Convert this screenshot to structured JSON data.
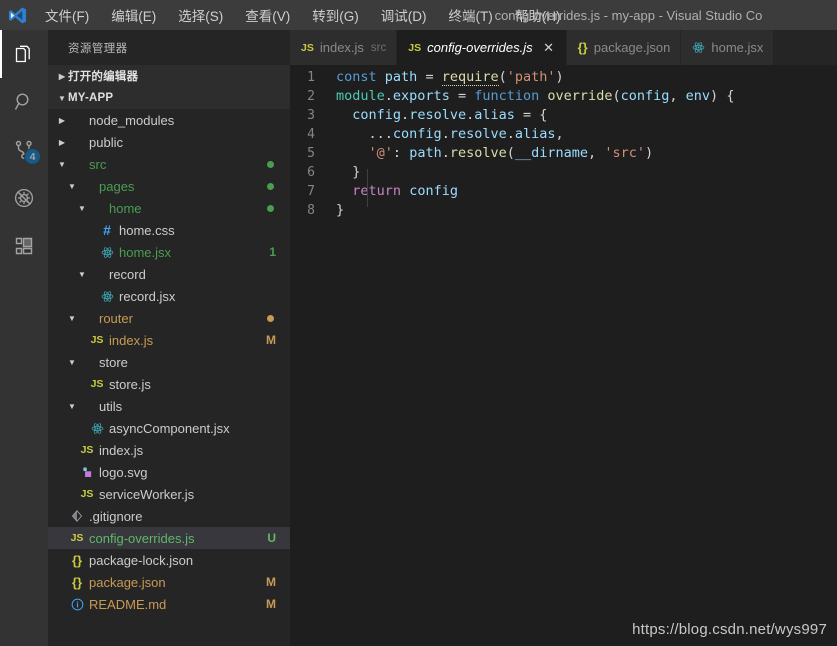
{
  "titlebar": {
    "logo_icon": "vscode-logo-icon",
    "menu": [
      {
        "label": "文件(F)",
        "name": "menu-file"
      },
      {
        "label": "编辑(E)",
        "name": "menu-edit"
      },
      {
        "label": "选择(S)",
        "name": "menu-selection"
      },
      {
        "label": "查看(V)",
        "name": "menu-view"
      },
      {
        "label": "转到(G)",
        "name": "menu-go"
      },
      {
        "label": "调试(D)",
        "name": "menu-debug"
      },
      {
        "label": "终端(T)",
        "name": "menu-terminal"
      },
      {
        "label": "帮助(H)",
        "name": "menu-help"
      }
    ],
    "window_title": "config-overrides.js - my-app - Visual Studio Co"
  },
  "activitybar": {
    "items": [
      {
        "icon": "explorer-files-icon",
        "active": true,
        "badge": ""
      },
      {
        "icon": "search-icon",
        "active": false,
        "badge": ""
      },
      {
        "icon": "source-control-icon",
        "active": false,
        "badge": "4"
      },
      {
        "icon": "debug-icon",
        "active": false,
        "badge": ""
      },
      {
        "icon": "extensions-icon",
        "active": false,
        "badge": ""
      }
    ]
  },
  "sidebar": {
    "title": "资源管理器",
    "open_editors_label": "打开的编辑器",
    "root_label": "MY-APP",
    "tree": [
      {
        "label": "node_modules",
        "indent": 1,
        "twisty": "collapsed",
        "icon": "",
        "state": "c-normal",
        "deco": "",
        "dot": ""
      },
      {
        "label": "public",
        "indent": 1,
        "twisty": "collapsed",
        "icon": "",
        "state": "c-normal",
        "deco": "",
        "dot": ""
      },
      {
        "label": "src",
        "indent": 1,
        "twisty": "expanded",
        "icon": "",
        "state": "c-green",
        "deco": "",
        "dot": "#4a9e51"
      },
      {
        "label": "pages",
        "indent": 2,
        "twisty": "expanded",
        "icon": "",
        "state": "c-green",
        "deco": "",
        "dot": "#4a9e51"
      },
      {
        "label": "home",
        "indent": 3,
        "twisty": "expanded",
        "icon": "",
        "state": "c-green",
        "deco": "",
        "dot": "#4a9e51"
      },
      {
        "label": "home.css",
        "indent": 4,
        "twisty": "none",
        "icon": "css-icon",
        "state": "c-normal",
        "deco": "",
        "dot": ""
      },
      {
        "label": "home.jsx",
        "indent": 4,
        "twisty": "none",
        "icon": "react-icon",
        "state": "c-green",
        "deco": "1",
        "dot": ""
      },
      {
        "label": "record",
        "indent": 3,
        "twisty": "expanded",
        "icon": "",
        "state": "c-normal",
        "deco": "",
        "dot": ""
      },
      {
        "label": "record.jsx",
        "indent": 4,
        "twisty": "none",
        "icon": "react-icon",
        "state": "c-normal",
        "deco": "",
        "dot": ""
      },
      {
        "label": "router",
        "indent": 2,
        "twisty": "expanded",
        "icon": "",
        "state": "c-orange",
        "deco": "",
        "dot": "#c99a54"
      },
      {
        "label": "index.js",
        "indent": 3,
        "twisty": "none",
        "icon": "js-icon",
        "state": "c-orange",
        "deco": "M",
        "dot": ""
      },
      {
        "label": "store",
        "indent": 2,
        "twisty": "expanded",
        "icon": "",
        "state": "c-normal",
        "deco": "",
        "dot": ""
      },
      {
        "label": "store.js",
        "indent": 3,
        "twisty": "none",
        "icon": "js-icon",
        "state": "c-normal",
        "deco": "",
        "dot": ""
      },
      {
        "label": "utils",
        "indent": 2,
        "twisty": "expanded",
        "icon": "",
        "state": "c-normal",
        "deco": "",
        "dot": ""
      },
      {
        "label": "asyncComponent.jsx",
        "indent": 3,
        "twisty": "none",
        "icon": "react-icon",
        "state": "c-normal",
        "deco": "",
        "dot": ""
      },
      {
        "label": "index.js",
        "indent": 2,
        "twisty": "none",
        "icon": "js-icon",
        "state": "c-normal",
        "deco": "",
        "dot": ""
      },
      {
        "label": "logo.svg",
        "indent": 2,
        "twisty": "none",
        "icon": "svg-icon",
        "state": "c-normal",
        "deco": "",
        "dot": ""
      },
      {
        "label": "serviceWorker.js",
        "indent": 2,
        "twisty": "none",
        "icon": "js-icon",
        "state": "c-normal",
        "deco": "",
        "dot": ""
      },
      {
        "label": ".gitignore",
        "indent": 1,
        "twisty": "none",
        "icon": "git-icon",
        "state": "c-normal",
        "deco": "",
        "dot": ""
      },
      {
        "label": "config-overrides.js",
        "indent": 1,
        "twisty": "none",
        "icon": "js-icon",
        "state": "c-sel-green",
        "deco": "U",
        "dot": "",
        "selected": true
      },
      {
        "label": "package-lock.json",
        "indent": 1,
        "twisty": "none",
        "icon": "json-icon",
        "state": "c-normal",
        "deco": "",
        "dot": ""
      },
      {
        "label": "package.json",
        "indent": 1,
        "twisty": "none",
        "icon": "json-icon",
        "state": "c-orange",
        "deco": "M",
        "dot": ""
      },
      {
        "label": "README.md",
        "indent": 1,
        "twisty": "none",
        "icon": "md-icon",
        "state": "c-orange",
        "deco": "M",
        "dot": ""
      }
    ]
  },
  "editor": {
    "tabs": [
      {
        "name": "index.js",
        "desc": "src",
        "icon": "js-icon",
        "active": false,
        "close": ""
      },
      {
        "name": "config-overrides.js",
        "desc": "",
        "icon": "js-icon",
        "active": true,
        "close": "✕"
      },
      {
        "name": "package.json",
        "desc": "",
        "icon": "json-icon",
        "active": false,
        "close": ""
      },
      {
        "name": "home.jsx",
        "desc": "",
        "icon": "react-icon",
        "active": false,
        "close": ""
      }
    ],
    "line_numbers": [
      "1",
      "2",
      "3",
      "4",
      "5",
      "6",
      "7",
      "8"
    ],
    "code_lines": [
      "const path = require('path')",
      "module.exports = function override(config, env) {",
      "  config.resolve.alias = {",
      "    ...config.resolve.alias,",
      "    '@': path.resolve(__dirname, 'src')",
      "  }",
      "  return config",
      "}"
    ]
  },
  "watermark": "https://blog.csdn.net/wys997",
  "colors": {
    "accent": "#007acc",
    "editor_bg": "#1e1e1e",
    "sidebar_bg": "#252526",
    "activitybar_bg": "#333333",
    "titlebar_bg": "#3c3c3c",
    "selection_bg": "#37373d",
    "git_modified": "#c99a54",
    "git_untracked": "#4a9e51"
  }
}
